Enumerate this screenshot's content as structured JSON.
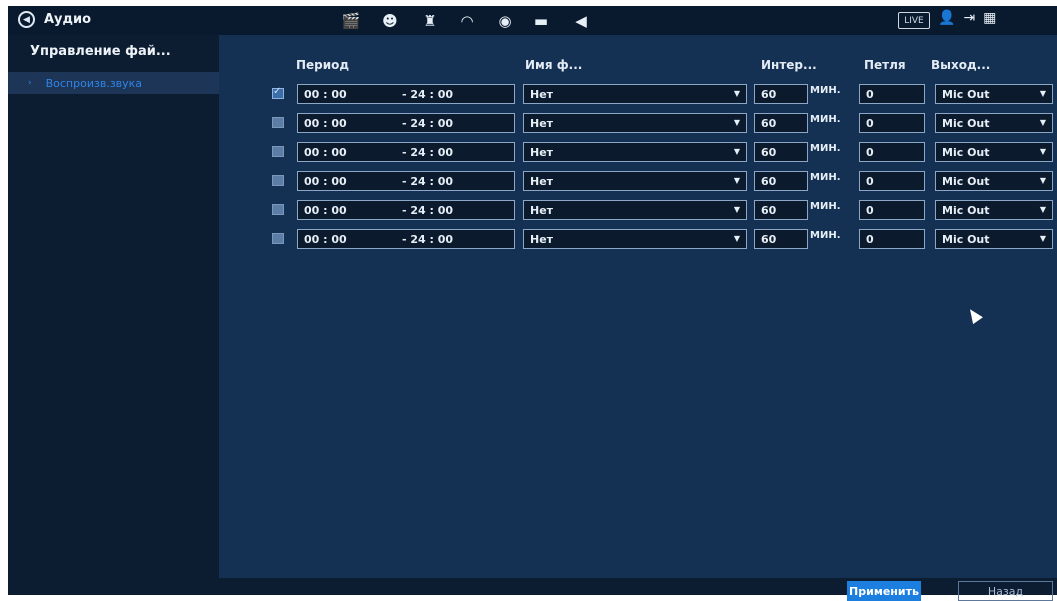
{
  "header": {
    "title": "Аудио",
    "title_icon": "speaker-icon",
    "menu_icons": [
      "clapperboard-icon",
      "brain-icon",
      "alarm-icon",
      "speedometer-icon",
      "record-icon",
      "monitor-icon",
      "speaker-icon"
    ],
    "live_label": "LIVE",
    "right_icons": [
      "user-icon",
      "logout-icon",
      "qr-icon"
    ]
  },
  "sidebar": {
    "header": "Управление фай...",
    "items": [
      {
        "label": "Воспроизв.звука",
        "active": true
      }
    ]
  },
  "table": {
    "columns": {
      "period": "Период",
      "file_name": "Имя ф...",
      "interval": "Интер...",
      "loop": "Петля",
      "output": "Выход..."
    },
    "unit_label": "МИН.",
    "rows": [
      {
        "checked": true,
        "start": "00 : 00",
        "end": "- 24 : 00",
        "file": "Нет",
        "interval": "60",
        "loop": "0",
        "output": "Mic Out"
      },
      {
        "checked": false,
        "start": "00 : 00",
        "end": "- 24 : 00",
        "file": "Нет",
        "interval": "60",
        "loop": "0",
        "output": "Mic Out"
      },
      {
        "checked": false,
        "start": "00 : 00",
        "end": "- 24 : 00",
        "file": "Нет",
        "interval": "60",
        "loop": "0",
        "output": "Mic Out"
      },
      {
        "checked": false,
        "start": "00 : 00",
        "end": "- 24 : 00",
        "file": "Нет",
        "interval": "60",
        "loop": "0",
        "output": "Mic Out"
      },
      {
        "checked": false,
        "start": "00 : 00",
        "end": "- 24 : 00",
        "file": "Нет",
        "interval": "60",
        "loop": "0",
        "output": "Mic Out"
      },
      {
        "checked": false,
        "start": "00 : 00",
        "end": "- 24 : 00",
        "file": "Нет",
        "interval": "60",
        "loop": "0",
        "output": "Mic Out"
      }
    ]
  },
  "footer": {
    "apply_label": "Применить",
    "back_label": "Назад"
  },
  "colors": {
    "accent": "#1c7fe0",
    "active_text": "#2f84e6",
    "panel": "#143053",
    "sidebar": "#0c1c31"
  }
}
